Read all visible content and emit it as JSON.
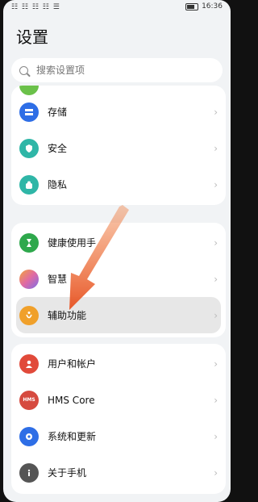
{
  "status": {
    "left_icons": "☷ ☷ ☷ ☷ ☰",
    "time": "16:36"
  },
  "header": {
    "title": "设置"
  },
  "search": {
    "placeholder": "搜索设置项"
  },
  "groups": [
    {
      "items": [
        {
          "label": "存储",
          "icon": "storage-icon",
          "color": "#2e6ee6"
        },
        {
          "label": "安全",
          "icon": "shield-icon",
          "color": "#2fb6a7"
        },
        {
          "label": "隐私",
          "icon": "privacy-icon",
          "color": "#2fb6a7"
        }
      ]
    },
    {
      "items": [
        {
          "label": "健康使用手",
          "icon": "hourglass-icon",
          "color": "#2ea84c"
        },
        {
          "label": "智慧",
          "icon": "smart-assistant-icon",
          "color": "#e06aa3"
        },
        {
          "label": "辅助功能",
          "icon": "accessibility-icon",
          "color": "#f0a02a"
        }
      ]
    },
    {
      "items": [
        {
          "label": "用户和帐户",
          "icon": "user-icon",
          "color": "#e14a3a"
        },
        {
          "label": "HMS Core",
          "icon": "hms-icon",
          "color": "#d64a3f"
        },
        {
          "label": "系统和更新",
          "icon": "gear-icon",
          "color": "#2e6ee6"
        },
        {
          "label": "关于手机",
          "icon": "info-icon",
          "color": "#555555"
        }
      ]
    }
  ],
  "hms_badge": "HMS"
}
